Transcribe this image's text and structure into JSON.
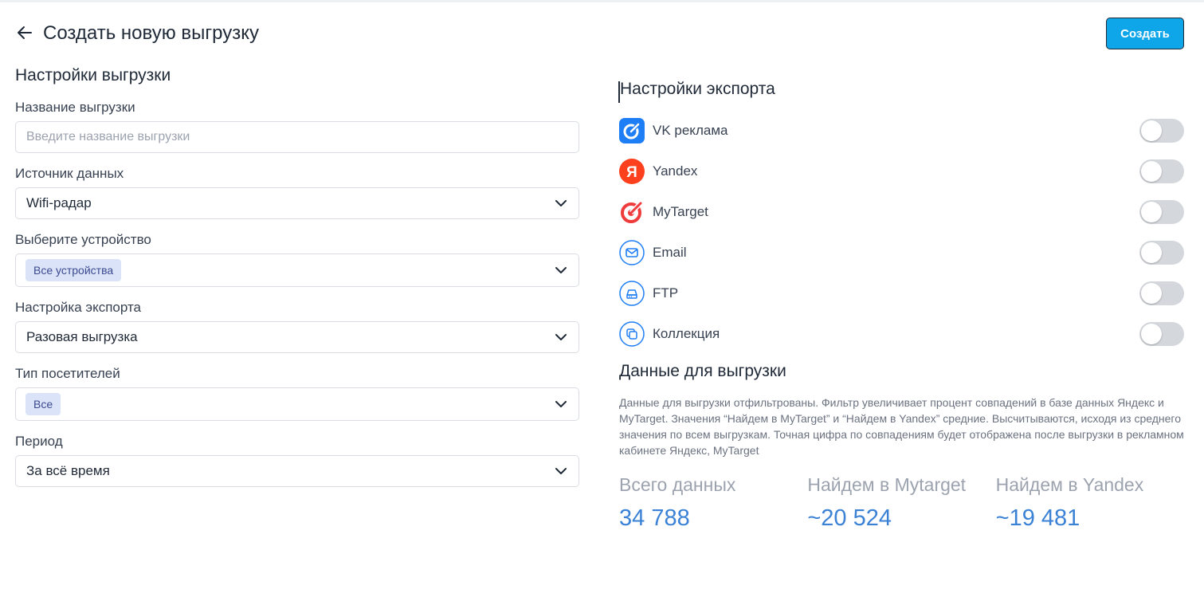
{
  "header": {
    "title": "Создать новую выгрузку",
    "create_label": "Создать"
  },
  "settings": {
    "title": "Настройки выгрузки",
    "name_field": {
      "label": "Название выгрузки",
      "placeholder": "Введите название выгрузки",
      "value": ""
    },
    "source_field": {
      "label": "Источник данных",
      "value": "Wifi-радар"
    },
    "device_field": {
      "label": "Выберите устройство",
      "chip": "Все устройства"
    },
    "export_field": {
      "label": "Настройка экспорта",
      "value": "Разовая выгрузка"
    },
    "visitors_field": {
      "label": "Тип посетителей",
      "chip": "Все"
    },
    "period_field": {
      "label": "Период",
      "value": "За всё время"
    }
  },
  "export": {
    "title": "Настройки экспорта",
    "items": [
      {
        "label": "VK реклама",
        "icon": "vk-ads-icon",
        "enabled": false
      },
      {
        "label": "Yandex",
        "icon": "yandex-icon",
        "enabled": false
      },
      {
        "label": "MyTarget",
        "icon": "mytarget-icon",
        "enabled": false
      },
      {
        "label": "Email",
        "icon": "email-icon",
        "enabled": false
      },
      {
        "label": "FTP",
        "icon": "ftp-icon",
        "enabled": false
      },
      {
        "label": "Коллекция",
        "icon": "collection-icon",
        "enabled": false
      }
    ]
  },
  "data_section": {
    "title": "Данные для выгрузки",
    "description": "Данные для выгрузки отфильтрованы. Фильтр увеличивает процент совпадений в базе данных Яндекс и MyTarget. Значения “Найдем в MyTarget” и “Найдем в Yandex” средние. Высчитываются, исходя из среднего значения по всем выгрузкам. Точная цифра по совпадениям будет отображена после выгрузки в рекламном кабинете Яндекс, MyTarget",
    "stats": [
      {
        "label": "Всего данных",
        "value": "34 788"
      },
      {
        "label": "Найдем в Mytarget",
        "value": "~20 524"
      },
      {
        "label": "Найдем в Yandex",
        "value": "~19 481"
      }
    ]
  },
  "colors": {
    "accent": "#0ea5e9",
    "stat_value": "#3b82d6",
    "chip_bg": "#dbe3f8",
    "toggle_off": "#d4d7dc"
  }
}
